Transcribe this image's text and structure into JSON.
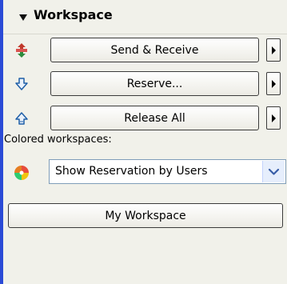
{
  "section": {
    "title": "Workspace",
    "toggle_icon": "triangle-down-icon"
  },
  "actions": [
    {
      "label": "Send & Receive",
      "icon": "send-receive-icon",
      "icon_color": "#c0392b"
    },
    {
      "label": "Reserve...",
      "icon": "reserve-arrow-down-icon",
      "icon_color": "#1f5fa8"
    },
    {
      "label": "Release All",
      "icon": "release-arrow-up-icon",
      "icon_color": "#1f5fa8"
    }
  ],
  "colored_workspaces": {
    "label": "Colored workspaces:",
    "selected_option": "Show Reservation by Users",
    "icon": "color-wheel-icon"
  },
  "my_workspace_label": "My Workspace",
  "colors": {
    "accent_bar": "#2b4bd6",
    "panel_background": "#f1f1ea",
    "select_border": "#7f9db9",
    "select_arrow_bg": "#e6eefc"
  }
}
